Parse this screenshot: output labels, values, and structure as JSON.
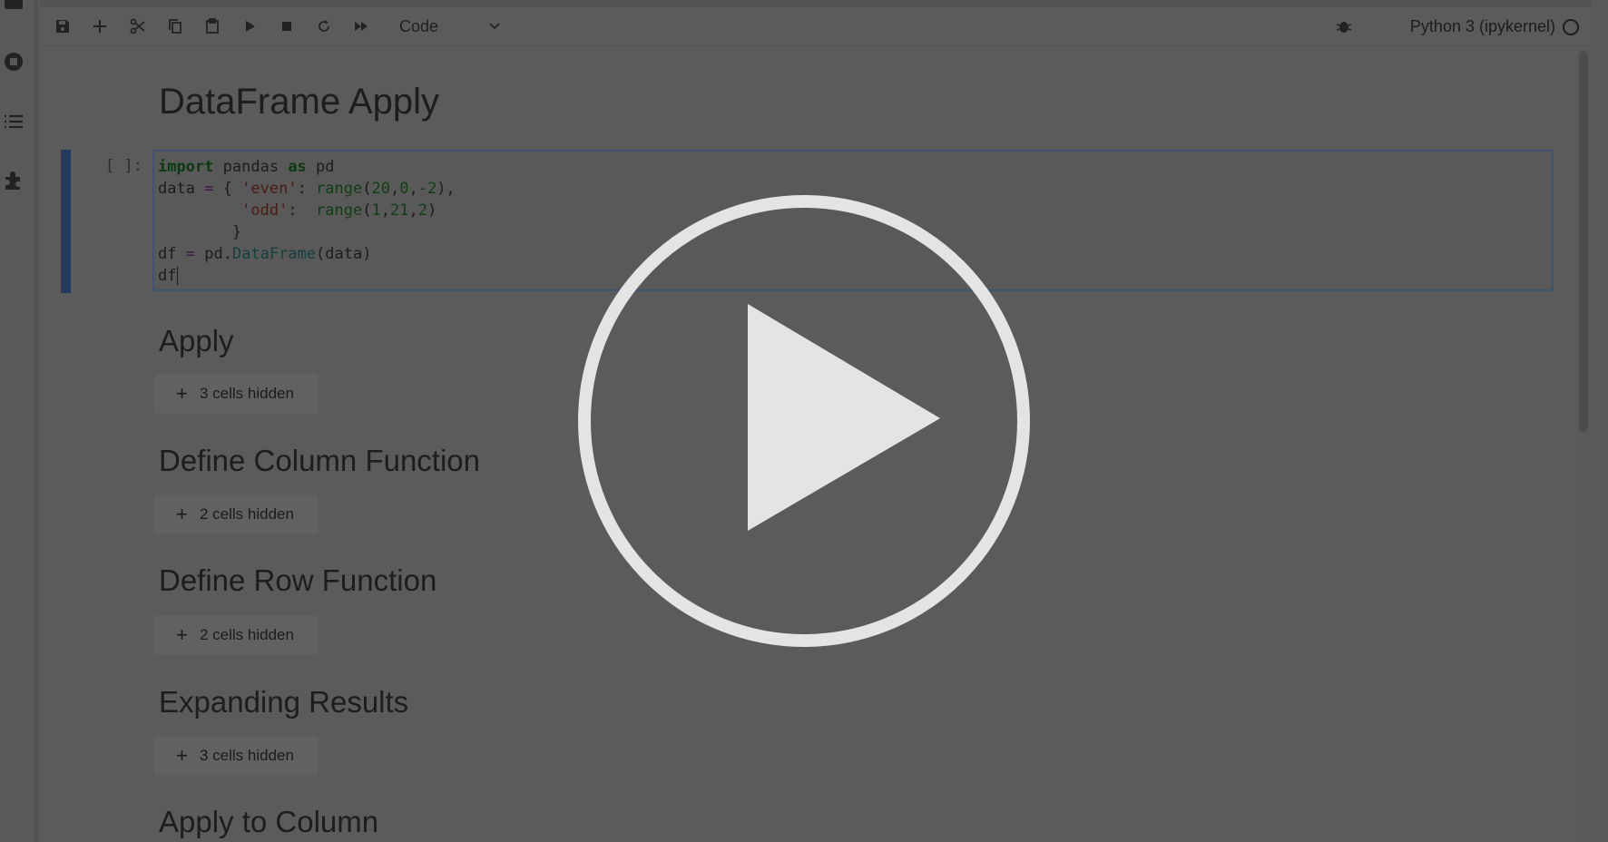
{
  "toolbar": {
    "cell_type": "Code",
    "kernel_name": "Python 3 (ipykernel)"
  },
  "notebook": {
    "title": "DataFrame Apply",
    "code_cell": {
      "prompt": "[ ]:",
      "lines": {
        "l1": [
          "import",
          " pandas ",
          "as",
          " pd"
        ],
        "l2": [
          "data ",
          "=",
          " { ",
          "'even'",
          ": ",
          "range",
          "(",
          "20",
          ",",
          "0",
          ",",
          "-2",
          "),"
        ],
        "l3": [
          "         ",
          "'odd'",
          ":  ",
          "range",
          "(",
          "1",
          ",",
          "21",
          ",",
          "2",
          ")"
        ],
        "l4": "        }",
        "l5": [
          "df ",
          "=",
          " pd.",
          "DataFrame",
          "(data)"
        ],
        "l6": "df"
      }
    },
    "sections": [
      {
        "heading": "Apply",
        "hidden": "3 cells hidden"
      },
      {
        "heading": "Define Column Function",
        "hidden": "2 cells hidden"
      },
      {
        "heading": "Define Row Function",
        "hidden": "2 cells hidden"
      },
      {
        "heading": "Expanding Results",
        "hidden": "3 cells hidden"
      },
      {
        "heading": "Apply to Column"
      }
    ]
  },
  "colors": {
    "overlay_bg": "#5a5a5a",
    "play_icon": "#e4e4e4",
    "active_cell": "#213a60"
  }
}
